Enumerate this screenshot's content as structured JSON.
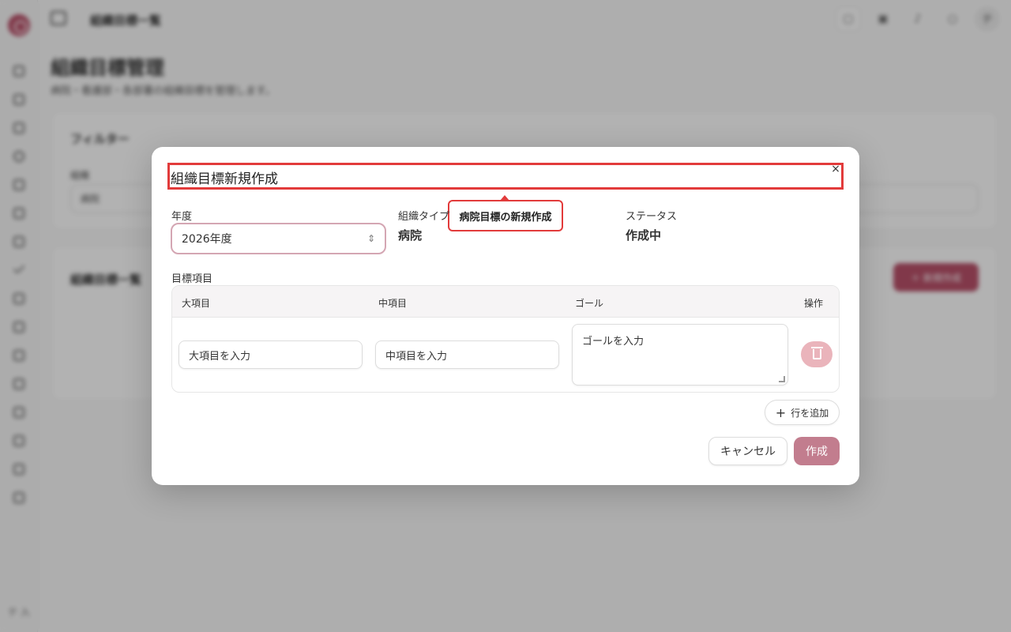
{
  "background": {
    "topbar_title": "組織目標一覧",
    "page_title": "組織目標管理",
    "page_description": "病院・看護部・各部署の組織目標を管理します。",
    "filter_card": {
      "title": "フィルター",
      "org_label": "組織",
      "org_value": "病院"
    },
    "list_card": {
      "title": "組織目標一覧",
      "new_button": "＋ 新規作成"
    },
    "sidebar_footer": "テ 入",
    "avatar_initial": "テ"
  },
  "modal": {
    "title": "組織目標新規作成",
    "close_icon": "×",
    "tooltip": "病院目標の新規作成",
    "year": {
      "label": "年度",
      "value": "2026年度"
    },
    "org_type": {
      "label": "組織タイプ",
      "value": "病院"
    },
    "status": {
      "label": "ステータス",
      "value": "作成中"
    },
    "goals_section_label": "目標項目",
    "table": {
      "headers": [
        "大項目",
        "中項目",
        "ゴール",
        "操作"
      ],
      "row": {
        "major_placeholder": "大項目を入力",
        "middle_placeholder": "中項目を入力",
        "goal_placeholder": "ゴールを入力"
      }
    },
    "add_row_button": "行を追加",
    "cancel_button": "キャンセル",
    "create_button": "作成"
  },
  "colors": {
    "accent": "#b9516a",
    "highlight": "#e23b3b",
    "delete_button": "#eab4bb",
    "create_button": "#c27d8e"
  }
}
